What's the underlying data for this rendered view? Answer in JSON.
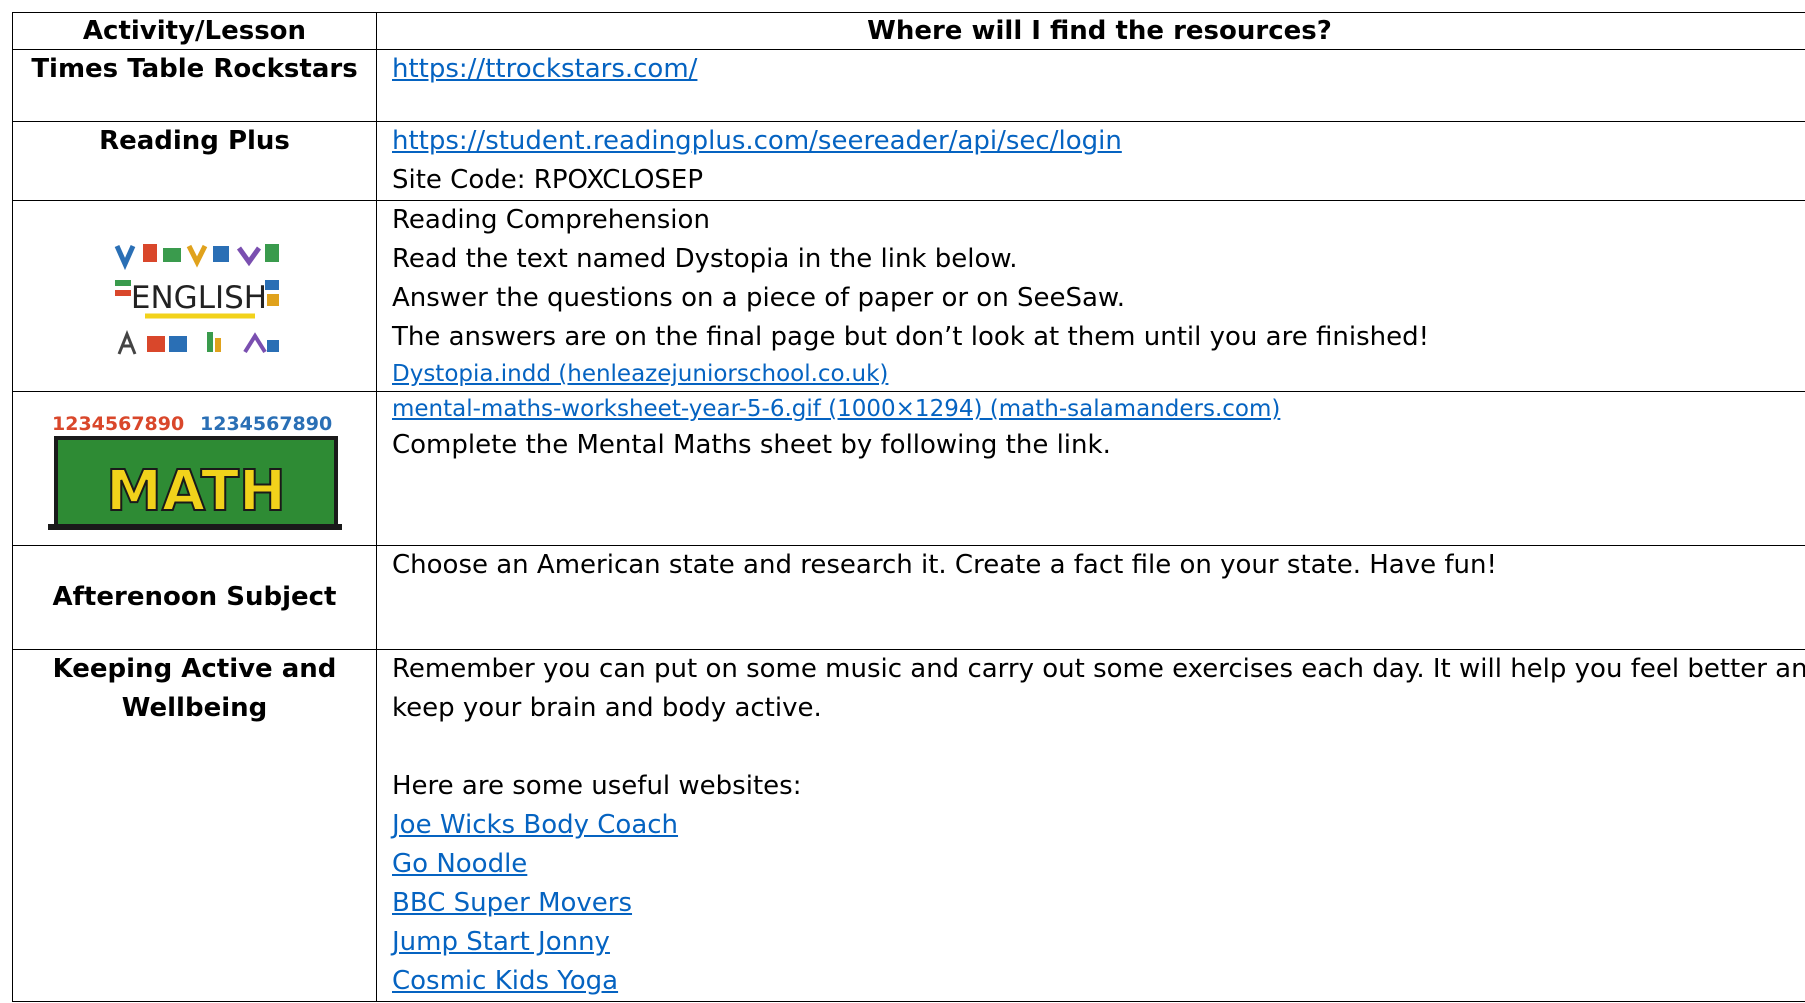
{
  "header": {
    "col1": "Activity/Lesson",
    "col2": "Where will I find the resources?"
  },
  "rows": {
    "ttr": {
      "label": "Times Table Rockstars",
      "link": "https://ttrockstars.com/"
    },
    "reading_plus": {
      "label": "Reading Plus",
      "link": "https://student.readingplus.com/seereader/api/sec/login",
      "site_code": "Site Code: RPOXCLOSEP"
    },
    "english": {
      "image_text": "ENGLISH",
      "line1": "Reading Comprehension",
      "line2": "Read the text named Dystopia in the link below.",
      "line3": "Answer the questions on a piece of paper or on SeeSaw.",
      "line4": "The answers are on the final page but don’t look at them until you are finished!",
      "link": "Dystopia.indd (henleazejuniorschool.co.uk)"
    },
    "math": {
      "image_text": "MATH",
      "image_numbers": "1234567890",
      "link": "mental-maths-worksheet-year-5-6.gif (1000×1294) (math-salamanders.com)",
      "line1": "Complete the Mental Maths sheet by following the link."
    },
    "afternoon": {
      "label": "Afterenoon Subject",
      "line1": "Choose an American state and research it. Create a fact file on your state. Have fun!"
    },
    "active": {
      "label_line1": "Keeping Active and",
      "label_line2": "Wellbeing",
      "line1": "Remember you can put on some music and carry out some exercises each day. It will help you feel better and",
      "line2": "keep your brain and body active.",
      "line3": "Here are some useful websites:",
      "links": [
        "Joe Wicks Body Coach",
        "Go Noodle",
        "BBC Super Movers",
        "Jump Start Jonny",
        "Cosmic Kids Yoga"
      ]
    }
  },
  "colors": {
    "link": "#0563c1",
    "math_banner": "#2e8b34",
    "math_letters": "#f2d21b"
  }
}
